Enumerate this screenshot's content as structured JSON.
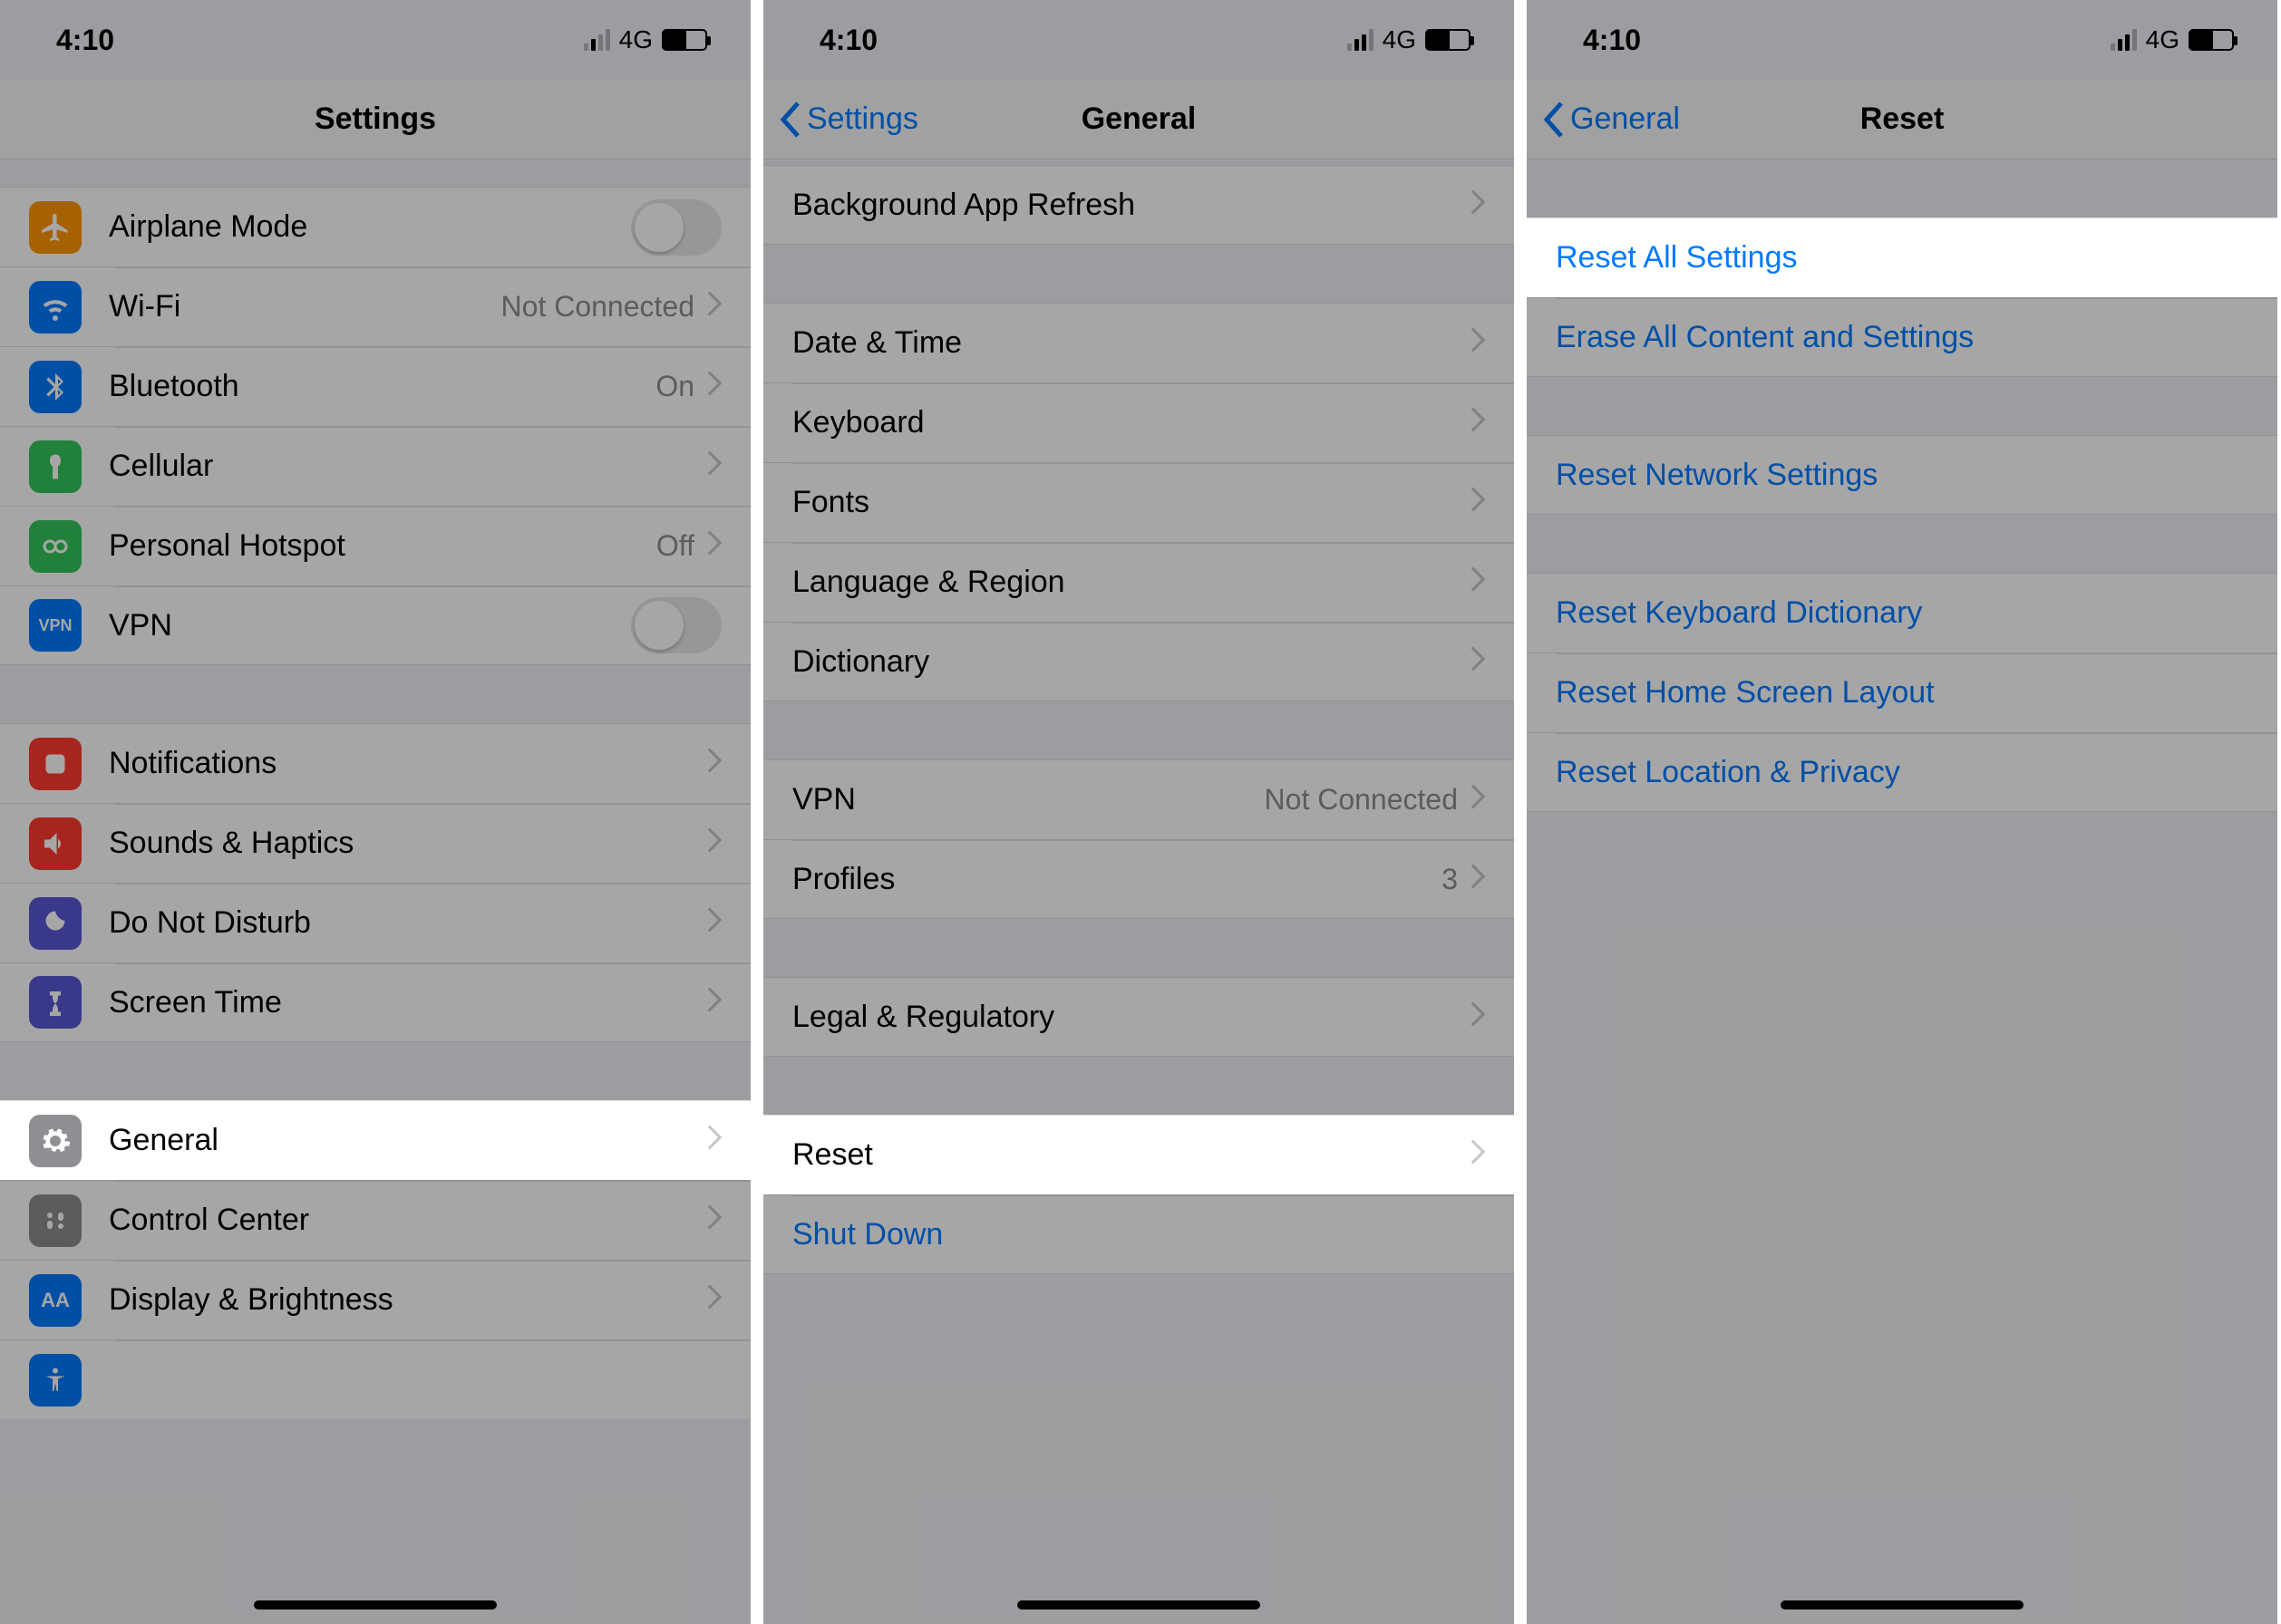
{
  "status": {
    "time": "4:10",
    "network": "4G"
  },
  "screen1": {
    "title": "Settings",
    "rows": {
      "airplane": "Airplane Mode",
      "wifi": "Wi-Fi",
      "wifi_detail": "Not Connected",
      "bluetooth": "Bluetooth",
      "bluetooth_detail": "On",
      "cellular": "Cellular",
      "hotspot": "Personal Hotspot",
      "hotspot_detail": "Off",
      "vpn": "VPN",
      "notifications": "Notifications",
      "sounds": "Sounds & Haptics",
      "dnd": "Do Not Disturb",
      "screentime": "Screen Time",
      "general": "General",
      "controlcenter": "Control Center",
      "display": "Display & Brightness"
    }
  },
  "screen2": {
    "back": "Settings",
    "title": "General",
    "rows": {
      "bg_refresh": "Background App Refresh",
      "datetime": "Date & Time",
      "keyboard": "Keyboard",
      "fonts": "Fonts",
      "language": "Language & Region",
      "dictionary": "Dictionary",
      "vpn": "VPN",
      "vpn_detail": "Not Connected",
      "profiles": "Profiles",
      "profiles_detail": "3",
      "legal": "Legal & Regulatory",
      "reset": "Reset",
      "shutdown": "Shut Down"
    }
  },
  "screen3": {
    "back": "General",
    "title": "Reset",
    "rows": {
      "reset_all": "Reset All Settings",
      "erase": "Erase All Content and Settings",
      "reset_network": "Reset Network Settings",
      "reset_keyboard": "Reset Keyboard Dictionary",
      "reset_home": "Reset Home Screen Layout",
      "reset_location": "Reset Location & Privacy"
    }
  }
}
